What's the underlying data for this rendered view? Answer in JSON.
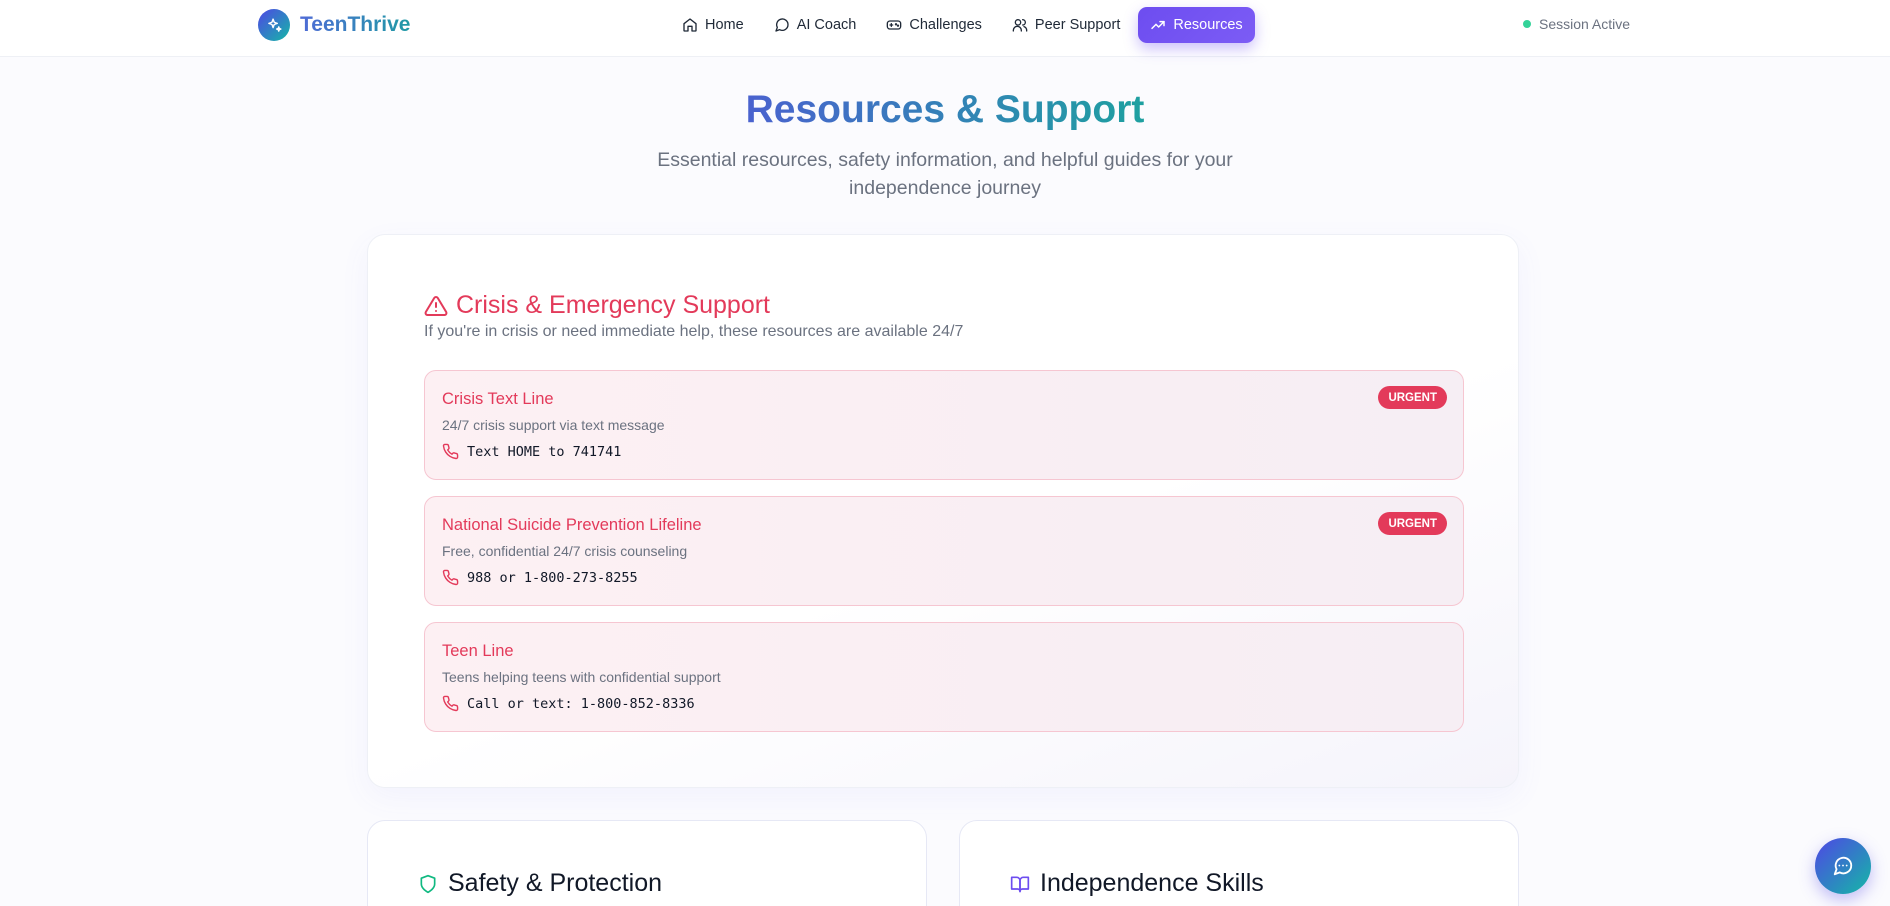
{
  "app": {
    "name": "TeenThrive"
  },
  "nav": {
    "items": [
      {
        "label": "Home",
        "icon": "home-icon"
      },
      {
        "label": "AI Coach",
        "icon": "chat-bubble-icon"
      },
      {
        "label": "Challenges",
        "icon": "gamepad-icon"
      },
      {
        "label": "Peer Support",
        "icon": "users-icon"
      },
      {
        "label": "Resources",
        "icon": "trending-up-icon",
        "active": true
      }
    ]
  },
  "session": {
    "label": "Session Active",
    "status_color": "#34d399"
  },
  "hero": {
    "title": "Resources & Support",
    "subtitle": "Essential resources, safety information, and helpful guides for your independence journey"
  },
  "crisis": {
    "title": "Crisis & Emergency Support",
    "description": "If you're in crisis or need immediate help, these resources are available 24/7",
    "accent": "#e33a5a",
    "items": [
      {
        "name": "Crisis Text Line",
        "description": "24/7 crisis support via text message",
        "contact": "Text HOME to 741741",
        "badge": "URGENT"
      },
      {
        "name": "National Suicide Prevention Lifeline",
        "description": "Free, confidential 24/7 crisis counseling",
        "contact": "988 or 1-800-273-8255",
        "badge": "URGENT"
      },
      {
        "name": "Teen Line",
        "description": "Teens helping teens with confidential support",
        "contact": "Call or text: 1-800-852-8336"
      }
    ]
  },
  "sections": [
    {
      "title": "Safety & Protection",
      "icon": "shield-icon",
      "icon_color": "#10b981"
    },
    {
      "title": "Independence Skills",
      "icon": "book-open-icon",
      "icon_color": "#6d4df0"
    }
  ],
  "colors": {
    "brand_primary": "#6d4df0",
    "brand_secondary": "#14b8a6"
  }
}
